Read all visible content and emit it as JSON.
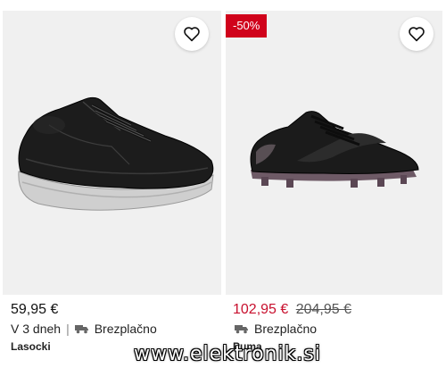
{
  "products": [
    {
      "price": "59,95 €",
      "old_price": "",
      "discount_badge": "",
      "delivery_time": "V 3 dneh",
      "shipping": "Brezplačno",
      "brand": "Lasocki",
      "image_icon": "black-leather-sneaker-image",
      "wishlist_icon": "heart-outline-icon"
    },
    {
      "price": "102,95 €",
      "old_price": "204,95 €",
      "discount_badge": "-50%",
      "delivery_time": "",
      "shipping": "Brezplačno",
      "brand": "Puma",
      "image_icon": "black-football-boot-image",
      "wishlist_icon": "heart-outline-icon"
    }
  ],
  "watermark": "www.elektronik.si",
  "colors": {
    "sale_price": "#c8102e",
    "badge_bg": "#d0021b",
    "image_bg": "#f0f0f0"
  }
}
